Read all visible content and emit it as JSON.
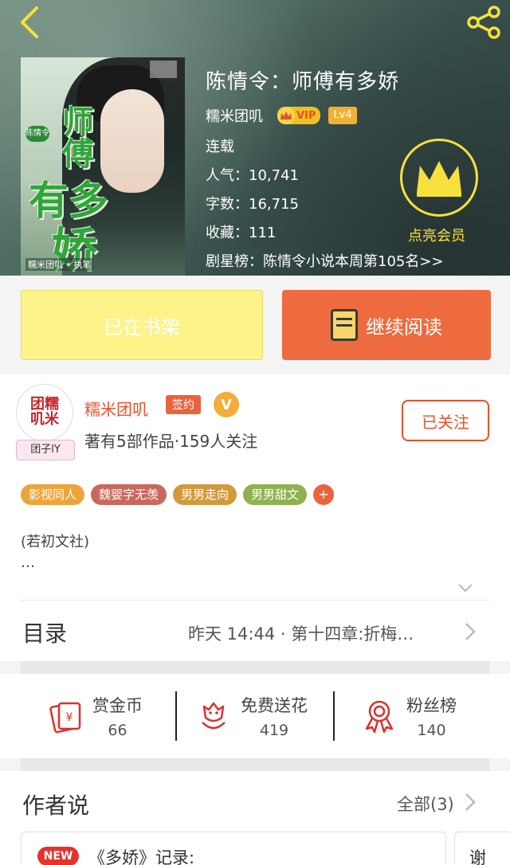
{
  "book": {
    "title": "陈情令：师傅有多娇",
    "author": "糯米团叽",
    "vip": "VIP",
    "level": "Lv4",
    "status": "连载",
    "popularity": "人气：10,741",
    "words": "字数：16,715",
    "favorites": "收藏：111",
    "rank": "剧星榜：陈情令小说本周第105名>>",
    "cover": {
      "art_title_1": "师傅",
      "art_title_2": "有多",
      "art_title_3": "娇",
      "series_badge": "陈情令",
      "author_line": "糯米团叽 • 执笔"
    }
  },
  "vip_promo": {
    "label": "点亮会员"
  },
  "buttons": {
    "shelf": "已在书架",
    "read": "继续阅读"
  },
  "author": {
    "avatar_text": "团糯叽米",
    "avatar_tag": "团子lY",
    "name": "糯米团叽",
    "sign_badge": "签约",
    "v_badge": "V",
    "stats": "著有5部作品·159人关注",
    "follow": "已关注"
  },
  "tags": [
    {
      "label": "影视同人",
      "color": "#eda43a"
    },
    {
      "label": "魏婴字无羡",
      "color": "#c9685c"
    },
    {
      "label": "男男走向",
      "color": "#d29a3c"
    },
    {
      "label": "男男甜文",
      "color": "#8fb250"
    }
  ],
  "tag_plus": "+",
  "description": {
    "line1": "(若初文社)",
    "line2": "…"
  },
  "toc": {
    "label": "目录",
    "latest": "昨天 14:44 · 第十四章:折梅…"
  },
  "actions": [
    {
      "label": "赏金币",
      "count": "66"
    },
    {
      "label": "免费送花",
      "count": "419"
    },
    {
      "label": "粉丝榜",
      "count": "140"
    }
  ],
  "author_says": {
    "label": "作者说",
    "all": "全部(3)",
    "new_badge": "NEW",
    "card1": "《多娇》记录:",
    "card2": "谢"
  },
  "colors": {
    "accent": "#e4532e",
    "yellow_button": "#fdf388",
    "orange_button": "#ed6b3e",
    "vip_gold": "#f7e13c"
  }
}
